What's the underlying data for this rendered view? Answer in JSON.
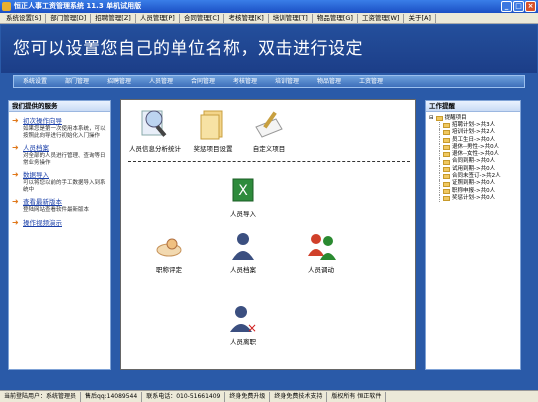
{
  "window": {
    "title": "恒正人事工资管理系统 11.3 单机试用版",
    "buttons": [
      "_",
      "□",
      "×"
    ]
  },
  "menu": [
    "系统设置[S]",
    "部门管理[D]",
    "招聘管理[Z]",
    "人员管理[P]",
    "合同管理[C]",
    "考核管理[K]",
    "培训管理[T]",
    "物品管理[G]",
    "工资管理[W]",
    "关于[A]"
  ],
  "banner": {
    "text": "您可以设置您自己的单位名称，双击进行设定"
  },
  "nav": [
    "系统设置",
    "部门管理",
    "招聘管理",
    "人员管理",
    "合同管理",
    "考核管理",
    "培训管理",
    "物品管理",
    "工资管理"
  ],
  "left_panel": {
    "title": "我们提供的服务",
    "items": [
      {
        "title": "初次操作向导",
        "desc": "如果您是第一次使用本系统，可以按照此向导进行初始化入门操作"
      },
      {
        "title": "人员档案",
        "desc": "对全部的人员进行管理、查询等日常业务操作"
      },
      {
        "title": "数据导入",
        "desc": "可以将您以前的手工数据导入到系统中"
      },
      {
        "title": "查看最新版本",
        "desc": "登陆网站查看软件最新版本"
      },
      {
        "title": "操作视频演示",
        "desc": ""
      }
    ]
  },
  "center": {
    "icons": [
      {
        "name": "staff-stats-icon",
        "label": "人员信息分析统计"
      },
      {
        "name": "reward-setup-icon",
        "label": "奖惩项目设置"
      },
      {
        "name": "custom-items-icon",
        "label": "自定义项目"
      },
      {
        "name": "import-staff-icon",
        "label": "人员导入"
      },
      {
        "name": "title-eval-icon",
        "label": "职称评定"
      },
      {
        "name": "staff-archive-icon",
        "label": "人员档案"
      },
      {
        "name": "staff-transfer-icon",
        "label": "人员调动"
      },
      {
        "name": "staff-leave-icon",
        "label": "人员离职"
      }
    ]
  },
  "right_panel": {
    "title": "工作提醒",
    "root": "提醒项目",
    "items": [
      "招聘计划->共3人",
      "培训计划->共2人",
      "员工生日->共0人",
      "退休--男性->共0人",
      "退休--女性->共0人",
      "合同到期->共0人",
      "试用到期->共0人",
      "合同未签订->共2人",
      "证照到期->共0人",
      "职称申报->共0人",
      "奖惩计划->共0人"
    ]
  },
  "status": [
    "当前登陆用户：系统管理员",
    "售后qq:14089544",
    "联系电话：010-51661409",
    "终身免费升级",
    "终身免费技术支持",
    "版权所有 恒正软件"
  ]
}
